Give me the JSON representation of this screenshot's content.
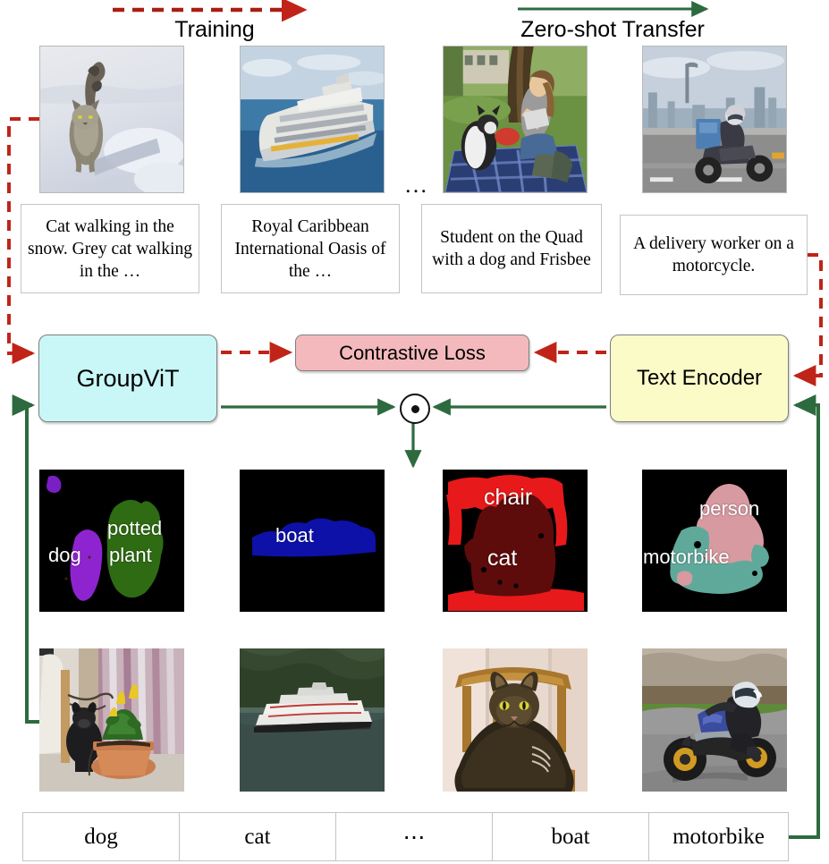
{
  "figure": {
    "title": "GroupViT contrastive training and zero-shot transfer overview"
  },
  "header": {
    "training_label": "Training",
    "zeroshot_label": "Zero-shot Transfer",
    "training_arrow_color": "#a81f12",
    "zeroshot_arrow_color": "#2d6b3f"
  },
  "training_images": [
    {
      "name": "cat-in-snow-photo",
      "alt": "Grey cat walking in the snow"
    },
    {
      "name": "cruise-ship-photo",
      "alt": "Royal Caribbean cruise ship at sea"
    },
    {
      "name": "student-with-dog-photo",
      "alt": "Student sitting on the quad with a dog and frisbee"
    },
    {
      "name": "delivery-rider-photo",
      "alt": "Delivery worker riding a motorcycle in a city"
    }
  ],
  "image_row_ellipsis": "…",
  "captions": [
    "Cat walking in the snow. Grey cat walking in the …",
    "Royal Caribbean International Oasis of the …",
    "Student on the Quad with a dog and Frisbee",
    "A delivery worker on a motorcycle."
  ],
  "models": {
    "image_encoder": {
      "label": "GroupViT",
      "fill": "#c9f7f7",
      "stroke": "#7f7f7f"
    },
    "text_encoder": {
      "label": "Text Encoder",
      "fill": "#fbfbc8",
      "stroke": "#7f7f7f"
    },
    "loss": {
      "label": "Contrastive Loss",
      "fill": "#f3b9bd",
      "stroke": "#7f7f7f"
    }
  },
  "dot_product": {
    "symbol": "⊙",
    "name": "dot-product-operator"
  },
  "segmentations": [
    {
      "name": "segmentation-dog-pottedplant",
      "labels": [
        {
          "text": "dog",
          "color": "#8e24d0"
        },
        {
          "text": "potted",
          "color": "#2e6b13"
        },
        {
          "text": "plant",
          "color": "#2e6b13"
        }
      ]
    },
    {
      "name": "segmentation-boat",
      "labels": [
        {
          "text": "boat",
          "color": "#0d11a8"
        }
      ]
    },
    {
      "name": "segmentation-chair-cat",
      "labels": [
        {
          "text": "chair",
          "color": "#e8191b"
        },
        {
          "text": "cat",
          "color": "#5e0b0b"
        }
      ]
    },
    {
      "name": "segmentation-person-motorbike",
      "labels": [
        {
          "text": "person",
          "color": "#d79aa0"
        },
        {
          "text": "motorbike",
          "color": "#5fa99b"
        }
      ]
    }
  ],
  "transfer_images": [
    {
      "name": "dog-and-pottedplant-photo",
      "alt": "Black dog next to a potted plant indoors"
    },
    {
      "name": "cruise-ship-fjord-photo",
      "alt": "Cruise ship on water in front of a forested hill"
    },
    {
      "name": "cat-on-chair-photo",
      "alt": "Tabby cat sitting on a wooden chair"
    },
    {
      "name": "motorbike-rider-photo",
      "alt": "Rider leaning a motorbike on a race track"
    }
  ],
  "class_table": {
    "cells": [
      "dog",
      "cat",
      "⋯",
      "boat",
      "motorbike"
    ]
  },
  "wires": {
    "training_color": "#c02418",
    "transfer_color": "#2d6b3f"
  }
}
